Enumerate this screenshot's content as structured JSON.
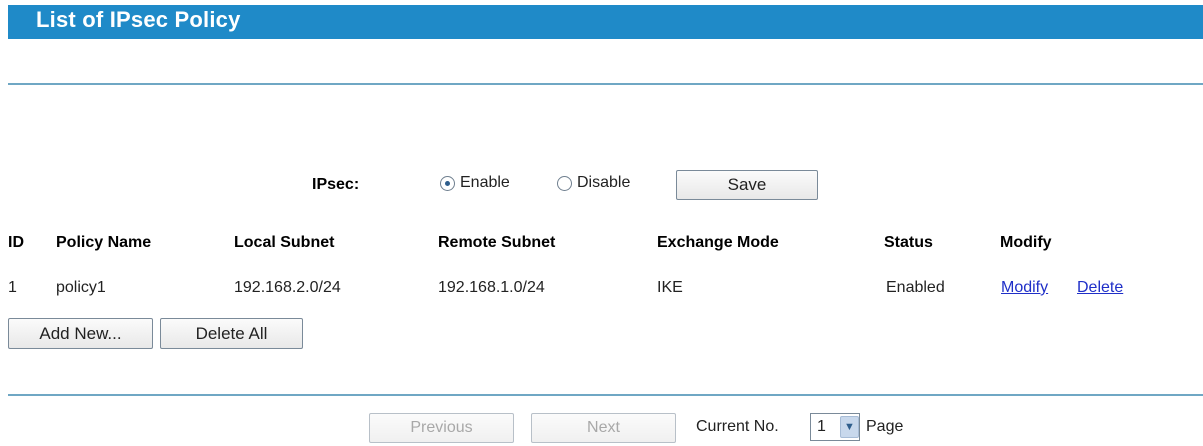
{
  "header": {
    "title": "List of IPsec Policy",
    "accent_color": "#1f8ac8"
  },
  "ipsec": {
    "label": "IPsec:",
    "options": [
      {
        "label": "Enable",
        "selected": true
      },
      {
        "label": "Disable",
        "selected": false
      }
    ],
    "save_label": "Save"
  },
  "table": {
    "headers": [
      "ID",
      "Policy Name",
      "Local Subnet",
      "Remote Subnet",
      "Exchange Mode",
      "Status",
      "Modify"
    ],
    "rows": [
      {
        "id": "1",
        "policy_name": "policy1",
        "local_subnet": "192.168.2.0/24",
        "remote_subnet": "192.168.1.0/24",
        "exchange_mode": "IKE",
        "status": "Enabled",
        "modify_label": "Modify",
        "delete_label": "Delete"
      }
    ]
  },
  "actions": {
    "add_new_label": "Add New...",
    "delete_all_label": "Delete All"
  },
  "pager": {
    "previous_label": "Previous",
    "next_label": "Next",
    "current_label": "Current No.",
    "current_value": "1",
    "page_label": "Page",
    "arrow_icon": "chevron-down-icon"
  }
}
